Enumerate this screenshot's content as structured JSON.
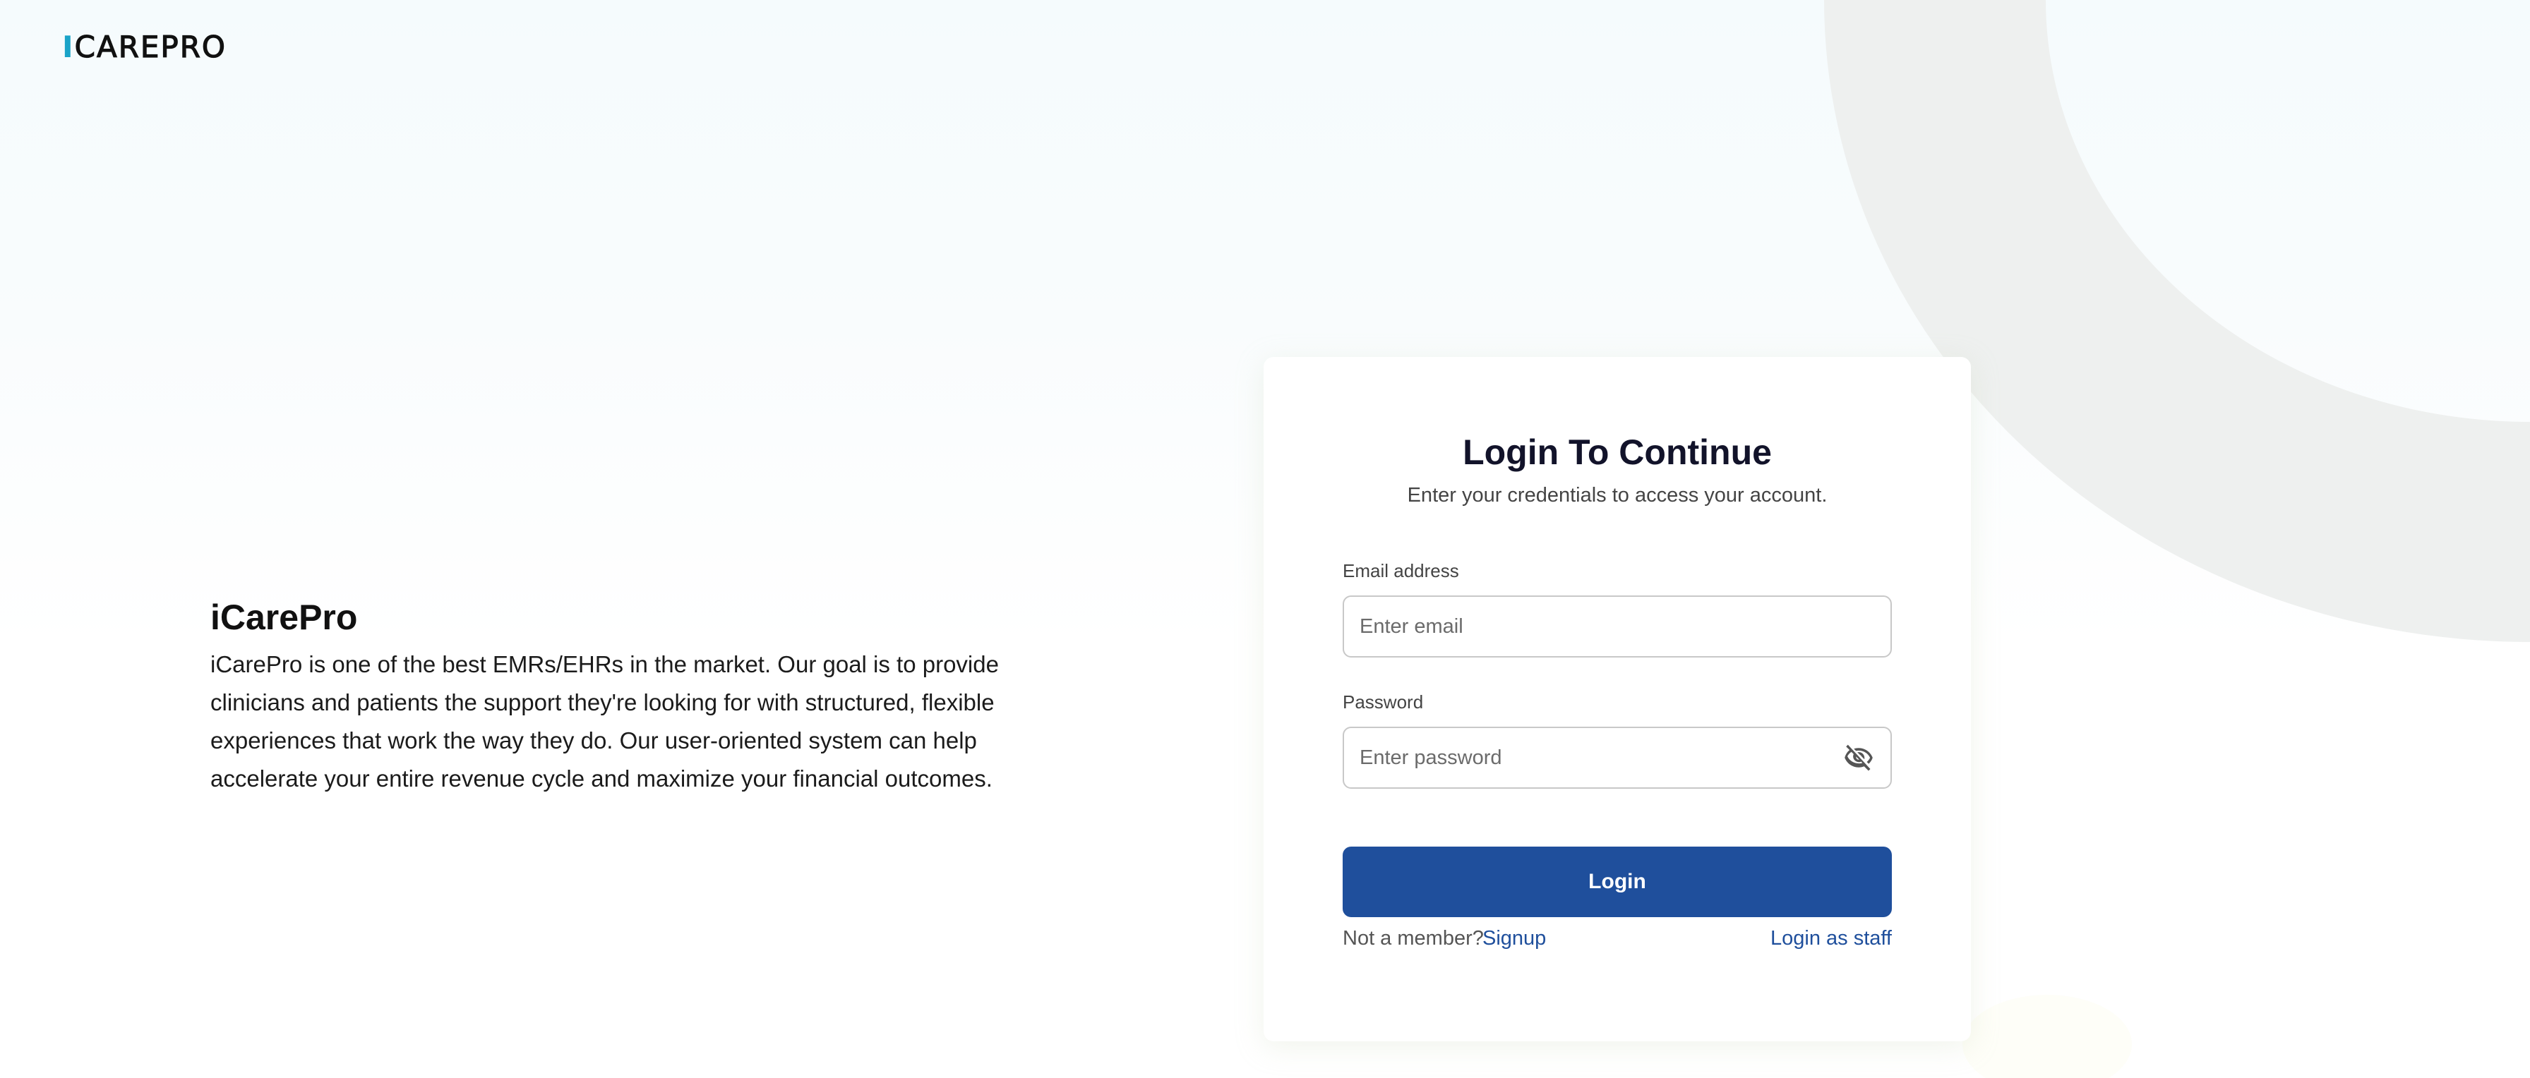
{
  "brand": {
    "logo_initial": "I",
    "logo_rest": "CAREPRO",
    "accent_color": "#1aa3c8"
  },
  "intro": {
    "title": "iCarePro",
    "text": "iCarePro is one of the best EMRs/EHRs in the market. Our goal is to provide clinicians and patients the support they're looking for with structured, flexible experiences that work the way they do. Our user-oriented system can help accelerate your entire revenue cycle and maximize your financial outcomes."
  },
  "login_card": {
    "title": "Login To Continue",
    "subtitle": "Enter your credentials to access your account.",
    "email_label": "Email address",
    "email_placeholder": "Enter email",
    "email_value": "",
    "password_label": "Password",
    "password_placeholder": "Enter password",
    "password_value": "",
    "password_toggle_icon": "eye-slash-icon",
    "login_button": "Login",
    "login_button_color": "#1f4f9c",
    "not_member_text": "Not a member?",
    "signup_link": "Signup",
    "staff_link": "Login as staff",
    "link_color": "#1f4f9c"
  }
}
